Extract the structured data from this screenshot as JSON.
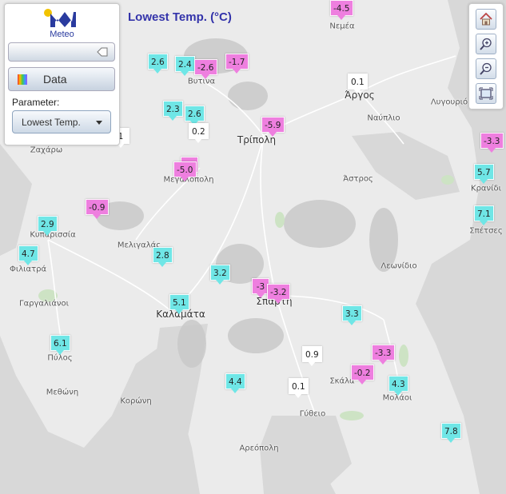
{
  "title": "Lowest Temp. (°C)",
  "panel": {
    "logo_text": "Meteo",
    "data_button_label": "Data",
    "parameter_label": "Parameter:",
    "parameter_value": "Lowest Temp."
  },
  "colors": {
    "cold_marker": "#ee7fdf",
    "near_zero_marker": "#ffffff",
    "warm_marker": "#6fe6e6",
    "title": "#3333aa",
    "accent": "#2a3b9f"
  },
  "tools": [
    "home-icon",
    "zoom-in-icon",
    "zoom-out-icon",
    "full-extent-icon"
  ],
  "towns": [
    {
      "name": "Νεμέα"
    },
    {
      "name": "Βυτινα"
    },
    {
      "name": "Άργος"
    },
    {
      "name": "Ναύπλιο"
    },
    {
      "name": "Λυγουριό"
    },
    {
      "name": "Τρίπολη"
    },
    {
      "name": "Ζαχάρω"
    },
    {
      "name": "Μεγαλόπολη"
    },
    {
      "name": "Άστρος"
    },
    {
      "name": "Κρανίδι"
    },
    {
      "name": "Κυπαρισσία"
    },
    {
      "name": "Σπέτσες"
    },
    {
      "name": "Μελιγαλάς"
    },
    {
      "name": "Φιλιατρά"
    },
    {
      "name": "Λεωνίδιο"
    },
    {
      "name": "Γαργαλιάνοι"
    },
    {
      "name": "Σπάρτη"
    },
    {
      "name": "Καλαμάτα"
    },
    {
      "name": "Πύλος"
    },
    {
      "name": "Σκάλα"
    },
    {
      "name": "Μεθώνη"
    },
    {
      "name": "Κορώνη"
    },
    {
      "name": "Μολάοι"
    },
    {
      "name": "Γύθειο"
    },
    {
      "name": "Αρεόπολη"
    }
  ],
  "stations": [
    {
      "value": "-4.5"
    },
    {
      "value": "2.6"
    },
    {
      "value": "2.4"
    },
    {
      "value": "-2.6"
    },
    {
      "value": "-1.7"
    },
    {
      "value": "0.1"
    },
    {
      "value": "2.3"
    },
    {
      "value": "2.6"
    },
    {
      "value": "1"
    },
    {
      "value": "0.2"
    },
    {
      "value": "-5.9"
    },
    {
      "value": "-3.3"
    },
    {
      "value": "-7"
    },
    {
      "value": "-5.0"
    },
    {
      "value": "5.7"
    },
    {
      "value": "-0.9"
    },
    {
      "value": "7.1"
    },
    {
      "value": "2.9"
    },
    {
      "value": "4.7"
    },
    {
      "value": "2.8"
    },
    {
      "value": "3.2"
    },
    {
      "value": "-3"
    },
    {
      "value": "-3.2"
    },
    {
      "value": "5.1"
    },
    {
      "value": "3.3"
    },
    {
      "value": "6.1"
    },
    {
      "value": "0.9"
    },
    {
      "value": "-3.3"
    },
    {
      "value": "-0.2"
    },
    {
      "value": "4.4"
    },
    {
      "value": "0.1"
    },
    {
      "value": "4.3"
    },
    {
      "value": "7.8"
    }
  ]
}
